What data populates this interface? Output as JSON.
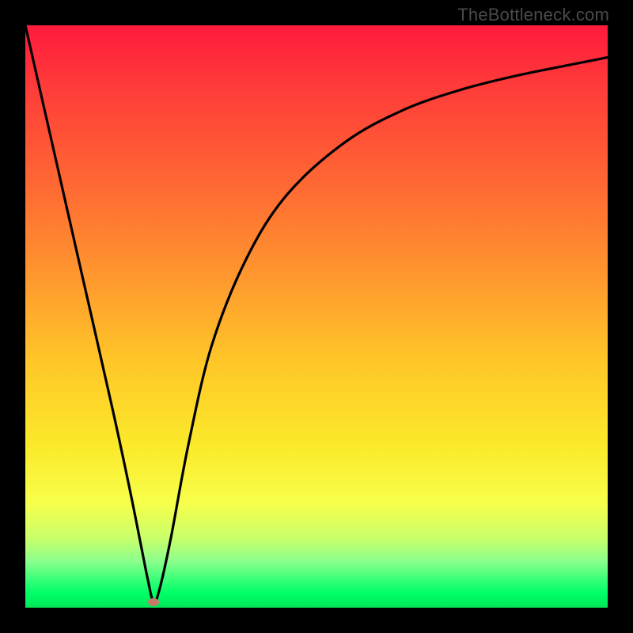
{
  "watermark": "TheBottleneck.com",
  "chart_data": {
    "type": "line",
    "title": "",
    "xlabel": "",
    "ylabel": "",
    "xlim": [
      0,
      100
    ],
    "ylim": [
      0,
      100
    ],
    "grid": false,
    "series": [
      {
        "name": "curve",
        "x": [
          0,
          5,
          10,
          15,
          18,
          20,
          21,
          22,
          23,
          25,
          28,
          32,
          38,
          45,
          55,
          65,
          75,
          85,
          95,
          100
        ],
        "y": [
          100,
          78,
          56,
          34,
          20,
          10,
          5,
          1,
          3,
          12,
          28,
          45,
          60,
          71,
          80,
          85.5,
          89,
          91.5,
          93.5,
          94.5
        ]
      }
    ],
    "marker": {
      "x": 22,
      "y": 1
    },
    "background_gradient": {
      "stops": [
        {
          "pos": 0.0,
          "color": "#ff1a3c"
        },
        {
          "pos": 0.28,
          "color": "#ff6a33"
        },
        {
          "pos": 0.58,
          "color": "#ffc728"
        },
        {
          "pos": 0.82,
          "color": "#f7ff4a"
        },
        {
          "pos": 0.95,
          "color": "#3cff7a"
        },
        {
          "pos": 1.0,
          "color": "#00e659"
        }
      ]
    }
  }
}
